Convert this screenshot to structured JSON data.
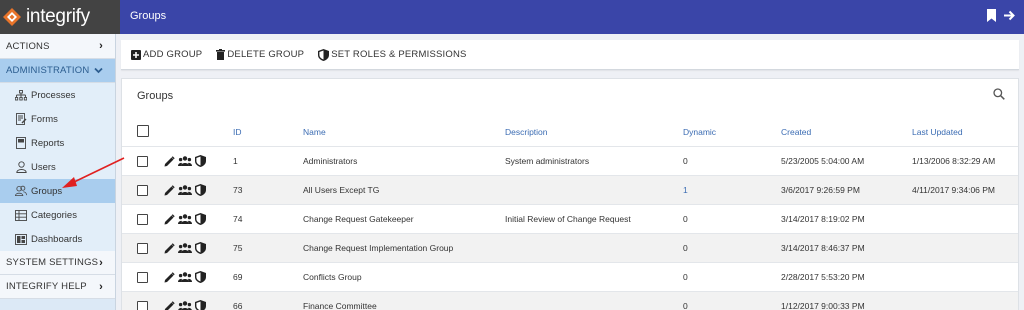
{
  "app": {
    "logo_text": "integrify",
    "page_title": "Groups",
    "colors": {
      "topbar": "#3a45a8",
      "logo_bg": "#434343",
      "accent": "#3b6cb3",
      "annotation": "#e02020"
    }
  },
  "sidebar": {
    "actions_label": "ACTIONS",
    "administration_label": "ADMINISTRATION",
    "admin_items": [
      {
        "label": "Processes",
        "icon": "sitemap-icon"
      },
      {
        "label": "Forms",
        "icon": "form-icon"
      },
      {
        "label": "Reports",
        "icon": "report-icon"
      },
      {
        "label": "Users",
        "icon": "user-icon"
      },
      {
        "label": "Groups",
        "icon": "group-icon",
        "selected": true
      },
      {
        "label": "Categories",
        "icon": "categories-icon"
      },
      {
        "label": "Dashboards",
        "icon": "dashboard-icon"
      }
    ],
    "system_settings_label": "SYSTEM SETTINGS",
    "integrify_help_label": "INTEGRIFY HELP"
  },
  "toolbar": {
    "add_group": "ADD GROUP",
    "delete_group": "DELETE GROUP",
    "set_roles": "SET ROLES & PERMISSIONS"
  },
  "panel": {
    "title": "Groups",
    "columns": {
      "id": "ID",
      "name": "Name",
      "description": "Description",
      "dynamic": "Dynamic",
      "created": "Created",
      "last_updated": "Last Updated"
    },
    "rows": [
      {
        "id": "1",
        "name": "Administrators",
        "description": "System administrators",
        "dynamic": "0",
        "created": "5/23/2005 5:04:00 AM",
        "last_updated": "1/13/2006 8:32:29 AM"
      },
      {
        "id": "73",
        "name": "All Users Except TG",
        "description": "",
        "dynamic": "1",
        "created": "3/6/2017 9:26:59 PM",
        "last_updated": "4/11/2017 9:34:06 PM"
      },
      {
        "id": "74",
        "name": "Change Request Gatekeeper",
        "description": "Initial Review of Change Request",
        "dynamic": "0",
        "created": "3/14/2017 8:19:02 PM",
        "last_updated": ""
      },
      {
        "id": "75",
        "name": "Change Request Implementation Group",
        "description": "",
        "dynamic": "0",
        "created": "3/14/2017 8:46:37 PM",
        "last_updated": ""
      },
      {
        "id": "69",
        "name": "Conflicts Group",
        "description": "",
        "dynamic": "0",
        "created": "2/28/2017 5:53:20 PM",
        "last_updated": ""
      },
      {
        "id": "66",
        "name": "Finance Committee",
        "description": "",
        "dynamic": "0",
        "created": "1/12/2017 9:00:33 PM",
        "last_updated": ""
      }
    ]
  }
}
